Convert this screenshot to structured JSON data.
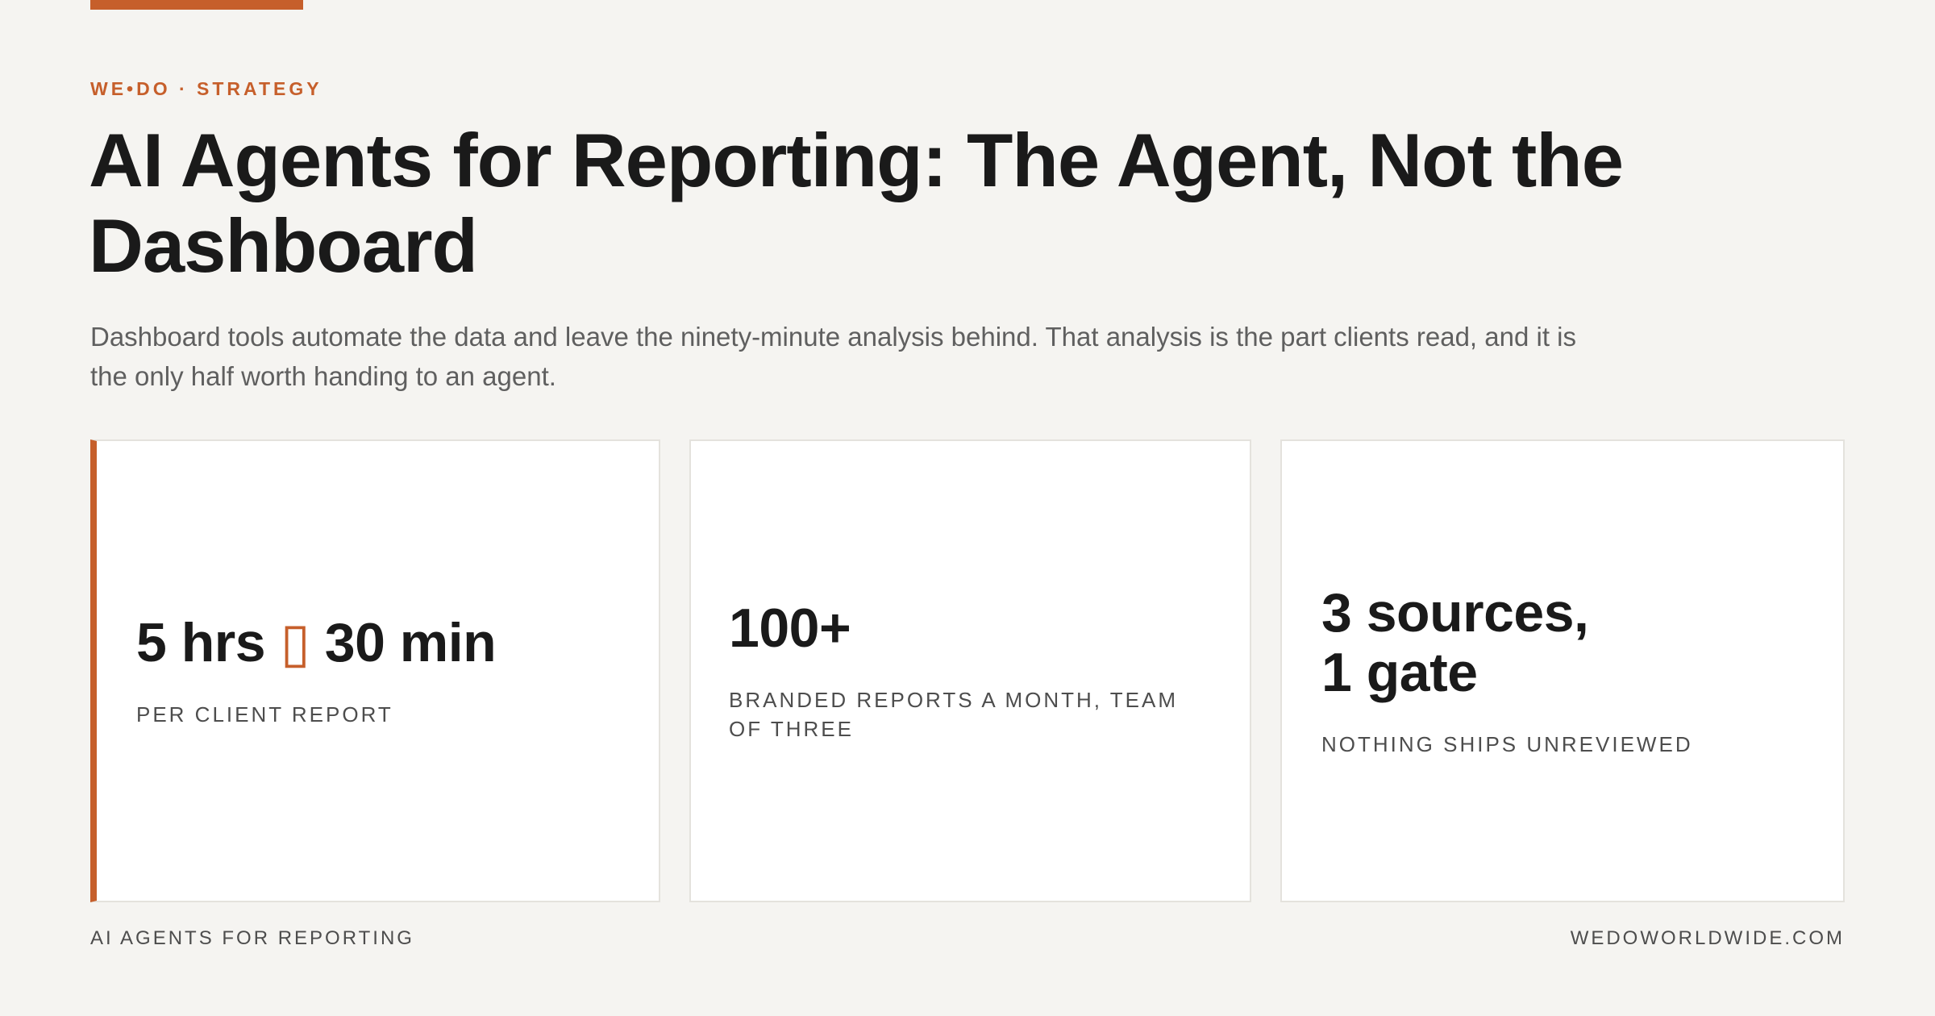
{
  "brand": {
    "accent_color": "#c65f2b",
    "eyebrow": "WE•DO · STRATEGY"
  },
  "hero": {
    "title": "AI Agents for Reporting: The Agent, Not the Dashboard",
    "subtitle": "Dashboard tools automate the data and leave the ninety-minute analysis behind. That analysis is the part clients read, and it is the only half worth handing to an agent."
  },
  "stats": [
    {
      "value_before": "5 hrs",
      "arrow_glyph": "▯",
      "value_after": "30 min",
      "label": "PER CLIENT REPORT"
    },
    {
      "value": "100+",
      "label": "BRANDED REPORTS A MONTH, TEAM OF THREE"
    },
    {
      "value_line1": "3 sources,",
      "value_line2": "1 gate",
      "label": "NOTHING SHIPS UNREVIEWED"
    }
  ],
  "footer": {
    "left": "AI AGENTS FOR REPORTING",
    "right": "WEDOWORLDWIDE.COM"
  }
}
